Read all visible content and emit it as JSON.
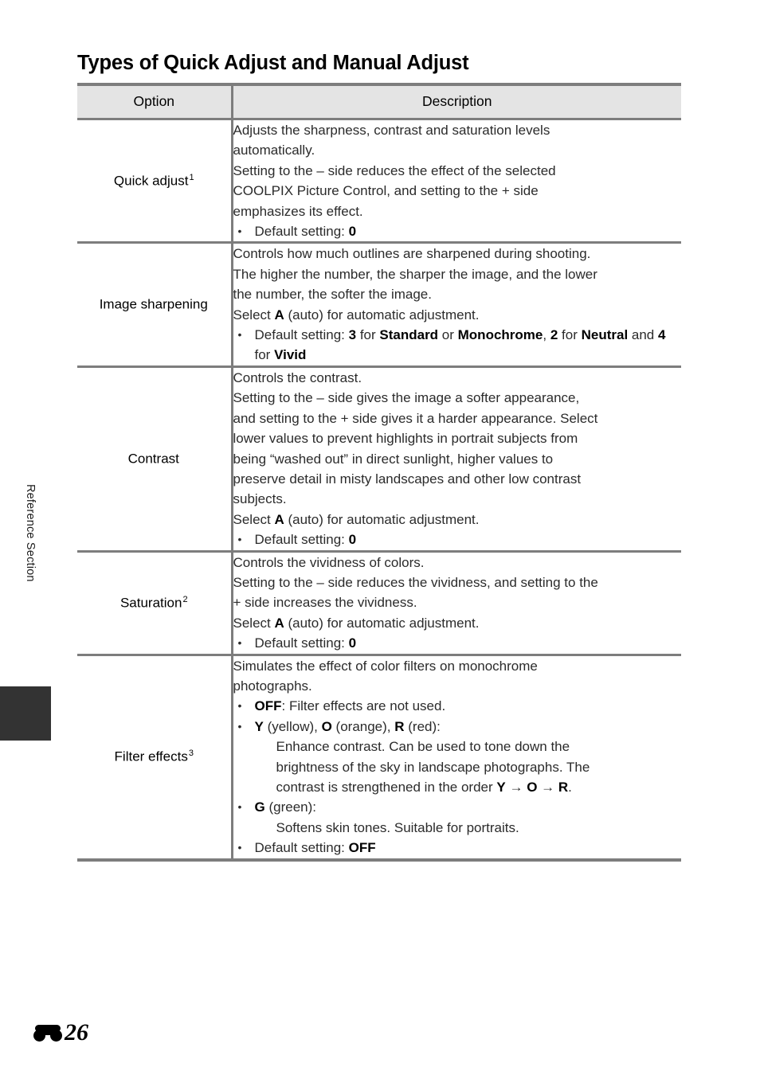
{
  "sidebar": {
    "section_label": "Reference Section",
    "tab_marker": "dark-tab"
  },
  "page": {
    "heading": "Types of Quick Adjust and Manual Adjust",
    "footer_icon": "e-section-glyph",
    "footer_page_number": "26"
  },
  "table": {
    "headers": {
      "option": "Option",
      "description": "Description"
    },
    "rows": [
      {
        "option_label": "Quick adjust",
        "option_footnote": "1",
        "lines": [
          "Adjusts the sharpness, contrast and saturation levels automatically.",
          "Setting to the – side reduces the effect of the selected COOLPIX Picture Control, and setting to the + side emphasizes its effect."
        ],
        "bullets": [
          {
            "prefix": "Default setting: ",
            "bold": "0",
            "suffix": ""
          }
        ]
      },
      {
        "option_label": "Image sharpening",
        "option_footnote": "",
        "lines": [
          "Controls how much outlines are sharpened during shooting. The higher the number, the sharper the image, and the lower the number, the softer the image.",
          "Select A (auto) for automatic adjustment."
        ],
        "bullets": [
          {
            "text": "Default setting: 3 for Standard or Monochrome, 2 for Neutral and 4 for Vivid"
          }
        ]
      },
      {
        "option_label": "Contrast",
        "option_footnote": "",
        "lines": [
          "Controls the contrast.",
          "Setting to the – side gives the image a softer appearance, and setting to the + side gives it a harder appearance. Select lower values to prevent highlights in portrait subjects from being “washed out” in direct sunlight, higher values to preserve detail in misty landscapes and other low contrast subjects.",
          "Select A (auto) for automatic adjustment."
        ],
        "bullets": [
          {
            "prefix": "Default setting: ",
            "bold": "0",
            "suffix": ""
          }
        ]
      },
      {
        "option_label": "Saturation",
        "option_footnote": "2",
        "lines": [
          "Controls the vividness of colors.",
          "Setting to the – side reduces the vividness, and setting to the + side increases the vividness.",
          "Select A (auto) for automatic adjustment."
        ],
        "bullets": [
          {
            "prefix": "Default setting: ",
            "bold": "0",
            "suffix": ""
          }
        ]
      },
      {
        "option_label": "Filter effects",
        "option_footnote": "3",
        "lines": [
          "Simulates the effect of color filters on monochrome photographs."
        ],
        "bullets": [
          {
            "text": "OFF: Filter effects are not used."
          },
          {
            "text": "Y (yellow), O (orange), R (red):"
          },
          {
            "text": "G (green):"
          },
          {
            "text": "Default setting: OFF"
          }
        ]
      }
    ],
    "row1": {
      "line1": "Adjusts the sharpness, contrast and saturation levels",
      "line2": "automatically.",
      "line3": "Setting to the – side reduces the effect of the selected",
      "line4": "COOLPIX Picture Control, and setting to the + side",
      "line5": "emphasizes its effect.",
      "bullet_label": "Default setting: ",
      "bullet_value": "0",
      "option": "Quick adjust",
      "footnote": "1"
    },
    "row2": {
      "line1": "Controls how much outlines are sharpened during shooting.",
      "line2": "The higher the number, the sharper the image, and the lower",
      "line3": "the number, the softer the image.",
      "select_pre": "Select ",
      "select_bold": "A",
      "select_post": " (auto) for automatic adjustment.",
      "bullet_pre": "Default setting: ",
      "b_3": "3",
      "for1": " for ",
      "b_standard": "Standard",
      "or": " or ",
      "b_monochrome": "Monochrome",
      "comma": ", ",
      "b_2": "2",
      "for2": " for ",
      "b_neutral": "Neutral",
      "and": " and ",
      "b_4": "4",
      "for3": " for ",
      "b_vivid": "Vivid",
      "option": "Image sharpening",
      "footnote": ""
    },
    "row3": {
      "line1": "Controls the contrast.",
      "line2": "Setting to the – side gives the image a softer appearance,",
      "line3": "and setting to the + side gives it a harder appearance. Select",
      "line4": "lower values to prevent highlights in portrait subjects from",
      "line5": "being “washed out” in direct sunlight, higher values to",
      "line6": "preserve detail in misty landscapes and other low contrast",
      "line7": "subjects.",
      "select_pre": "Select ",
      "select_bold": "A",
      "select_post": " (auto) for automatic adjustment.",
      "bullet_label": "Default setting: ",
      "bullet_value": "0",
      "option": "Contrast",
      "footnote": ""
    },
    "row4": {
      "line1": "Controls the vividness of colors.",
      "line2": "Setting to the – side reduces the vividness, and setting to the",
      "line3": "+ side increases the vividness.",
      "select_pre": "Select ",
      "select_bold": "A",
      "select_post": " (auto) for automatic adjustment.",
      "bullet_label": "Default setting: ",
      "bullet_value": "0",
      "option": "Saturation",
      "footnote": "2"
    },
    "row5": {
      "line1": "Simulates the effect of color filters on monochrome",
      "line2": "photographs.",
      "b_off": "OFF",
      "off_rest": ": Filter effects are not used.",
      "b_y": "Y",
      "y_rest": " (yellow), ",
      "b_o": "O",
      "o_rest": " (orange), ",
      "b_r": "R",
      "r_rest": " (red):",
      "enhance1": "Enhance contrast. Can be used to tone down the",
      "enhance2": "brightness of the sky in landscape photographs. The",
      "enhance3_pre": "contrast is strengthened in the order ",
      "arrow_y": "Y",
      "arrow1": " → ",
      "arrow_o": "O",
      "arrow2": " → ",
      "arrow_r": "R",
      "enhance3_post": ".",
      "b_g": "G",
      "g_rest": " (green):",
      "softens": "Softens skin tones. Suitable for portraits.",
      "bullet_label": "Default setting: ",
      "bullet_value": "OFF",
      "option": "Filter effects",
      "footnote": "3"
    }
  }
}
